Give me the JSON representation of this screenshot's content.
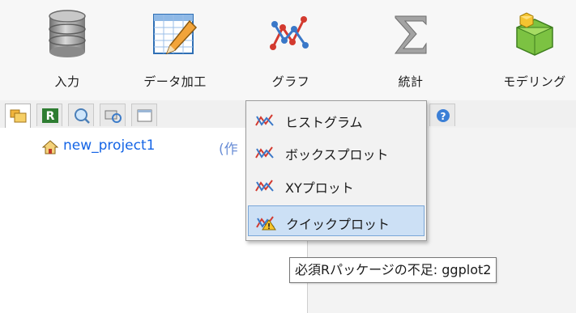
{
  "ribbon": {
    "tools": [
      {
        "label": "入力",
        "icon": "database-icon"
      },
      {
        "label": "データ加工",
        "icon": "spreadsheet-pencil-icon"
      },
      {
        "label": "グラフ",
        "icon": "line-graph-icon"
      },
      {
        "label": "統計",
        "icon": "sigma-icon"
      },
      {
        "label": "モデリング",
        "icon": "cubes-icon"
      }
    ]
  },
  "tabs": [
    {
      "icon": "folders-icon",
      "active": true
    },
    {
      "icon": "r-console-icon",
      "active": false
    },
    {
      "icon": "search-icon",
      "active": false
    },
    {
      "icon": "refresh-icon",
      "active": false
    },
    {
      "icon": "window-icon",
      "active": false
    },
    {
      "icon": "help-icon",
      "active": false
    }
  ],
  "project": {
    "name": "new_project1",
    "suffix_visible": "(作"
  },
  "graph_menu": {
    "items": [
      {
        "label": "ヒストグラム",
        "icon": "graph-icon"
      },
      {
        "label": "ボックスプロット",
        "icon": "graph-icon"
      },
      {
        "label": "XYプロット",
        "icon": "graph-icon"
      },
      {
        "label": "クイックプロット",
        "icon": "graph-warning-icon",
        "highlighted": true
      }
    ]
  },
  "tooltip": {
    "text": "必須Rパッケージの不足: ggplot2"
  },
  "colors": {
    "project_link": "#1565e6",
    "menu_highlight": "#cce0f5",
    "menu_highlight_border": "#7aa7d8"
  }
}
